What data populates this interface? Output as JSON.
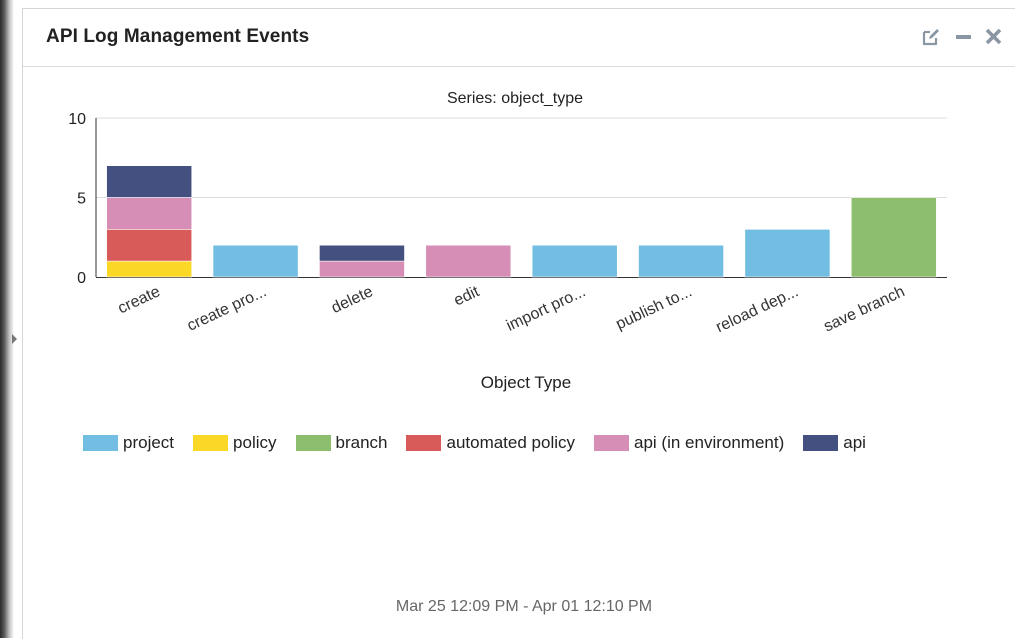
{
  "panel": {
    "title": "API Log Management Events",
    "date_range": "Mar 25 12:09 PM - Apr 01 12:10 PM",
    "icons": [
      "edit-icon",
      "minimize-icon",
      "close-icon"
    ]
  },
  "chart_data": {
    "type": "bar",
    "stacked": true,
    "title": "Series: object_type",
    "xlabel": "Object Type",
    "ylabel": "",
    "ylim": [
      0,
      10
    ],
    "yticks": [
      0,
      5,
      10
    ],
    "grid": true,
    "legend_position": "bottom",
    "categories": [
      "create",
      "create pro...",
      "delete",
      "edit",
      "import pro...",
      "publish to...",
      "reload dep...",
      "save branch"
    ],
    "series": [
      {
        "name": "project",
        "color": "#72bde2",
        "values": [
          0,
          2,
          0,
          0,
          2,
          2,
          3,
          0
        ]
      },
      {
        "name": "policy",
        "color": "#fcd826",
        "values": [
          1,
          0,
          0,
          0,
          0,
          0,
          0,
          0
        ]
      },
      {
        "name": "branch",
        "color": "#8dbe6d",
        "values": [
          0,
          0,
          0,
          0,
          0,
          0,
          0,
          5
        ]
      },
      {
        "name": "automated policy",
        "color": "#d85b59",
        "values": [
          2,
          0,
          0,
          0,
          0,
          0,
          0,
          0
        ]
      },
      {
        "name": "api (in environment)",
        "color": "#d68db6",
        "values": [
          2,
          0,
          1,
          2,
          0,
          0,
          0,
          0
        ]
      },
      {
        "name": "api",
        "color": "#44507f",
        "values": [
          2,
          0,
          1,
          0,
          0,
          0,
          0,
          0
        ]
      }
    ]
  }
}
